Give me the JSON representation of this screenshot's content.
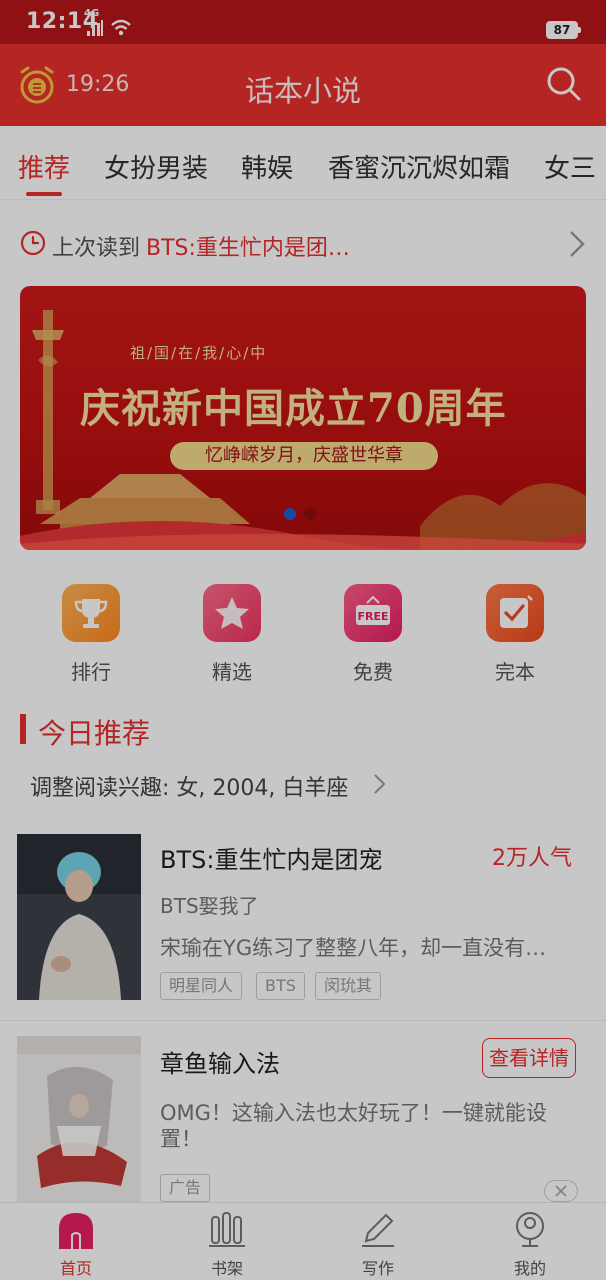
{
  "status_bar": {
    "time": "12:14",
    "network": "4G",
    "battery": "87"
  },
  "header": {
    "time": "19:26",
    "title": "话本小说"
  },
  "tabs": [
    {
      "label": "推荐"
    },
    {
      "label": "女扮男装"
    },
    {
      "label": "韩娱"
    },
    {
      "label": "香蜜沉沉烬如霜"
    },
    {
      "label": "女三"
    }
  ],
  "last_read": {
    "prefix": "上次读到",
    "title": "BTS:重生忙内是团…"
  },
  "banner": {
    "top_text": "祖/国/在/我/心/中",
    "headline": "庆祝新中国成立70周年",
    "sub": "忆峥嵘岁月，庆盛世华章"
  },
  "quick_entries": [
    {
      "label": "排行",
      "icon": "trophy-icon"
    },
    {
      "label": "精选",
      "icon": "star-icon"
    },
    {
      "label": "免费",
      "icon": "free-sign-icon",
      "badge": "FREE"
    },
    {
      "label": "完本",
      "icon": "check-note-icon"
    }
  ],
  "section": {
    "title": "今日推荐",
    "interest": "调整阅读兴趣: 女, 2004, 白羊座"
  },
  "books": [
    {
      "title": "BTS:重生忙内是团宠",
      "popularity": "2万人气",
      "subtitle": "BTS娶我了",
      "description": "宋瑜在YG练习了整整八年，却一直没有…",
      "tags": [
        "明星同人",
        "BTS",
        "闵玧其"
      ]
    }
  ],
  "ad": {
    "title": "章鱼输入法",
    "button": "查看详情",
    "description": "OMG！这输入法也太好玩了！一键就能设置！",
    "tag": "广告"
  },
  "bottom_nav": [
    {
      "label": "首页",
      "icon": "home-icon"
    },
    {
      "label": "书架",
      "icon": "bookshelf-icon"
    },
    {
      "label": "写作",
      "icon": "pen-icon"
    },
    {
      "label": "我的",
      "icon": "profile-icon"
    }
  ],
  "colors": {
    "accent": "#e8302d",
    "status_bar": "#b8161a"
  }
}
